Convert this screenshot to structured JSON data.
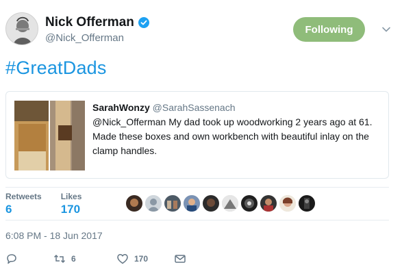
{
  "author": {
    "display_name": "Nick Offerman",
    "handle": "@Nick_Offerman",
    "verified": true,
    "follow_button_label": "Following",
    "follow_button_color": "#8fbc7a"
  },
  "tweet": {
    "text": "#GreatDads",
    "text_color": "#1b95e0"
  },
  "quoted_tweet": {
    "name": "SarahWonzy",
    "handle": "@SarahSassenach",
    "text": "@Nick_Offerman My dad took up woodworking 2 years ago at 61. Made these boxes and own workbench with beautiful inlay on the clamp handles."
  },
  "stats": {
    "retweets_label": "Retweets",
    "retweets_value": "6",
    "likes_label": "Likes",
    "likes_value": "170"
  },
  "likers_count_shown": 9,
  "timestamp": "6:08 PM - 18 Jun 2017",
  "actions": {
    "retweet_count": "6",
    "like_count": "170"
  }
}
